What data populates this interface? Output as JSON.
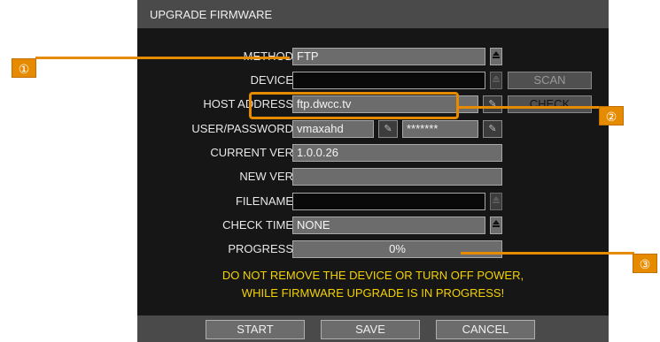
{
  "dialog": {
    "title": "UPGRADE FIRMWARE"
  },
  "form": {
    "method": {
      "label": "METHOD",
      "value": "FTP",
      "options_icon": "dropdown-arrow-icon"
    },
    "device": {
      "label": "DEVICE",
      "value": "",
      "button": "SCAN"
    },
    "host_address": {
      "label": "HOST ADDRESS",
      "value": "ftp.dwcc.tv",
      "button": "CHECK"
    },
    "user_password": {
      "label": "USER/PASSWORD",
      "user": "vmaxahd",
      "password": "*******"
    },
    "current_ver": {
      "label": "CURRENT VER",
      "value": "1.0.0.26"
    },
    "new_ver": {
      "label": "NEW VER",
      "value": ""
    },
    "filename": {
      "label": "FILENAME",
      "value": ""
    },
    "check_time": {
      "label": "CHECK TIME",
      "value": "NONE"
    },
    "progress": {
      "label": "PROGRESS",
      "value": "0%",
      "fraction": 0
    }
  },
  "warning": {
    "line1": "DO NOT REMOVE THE DEVICE OR TURN OFF POWER,",
    "line2": "WHILE FIRMWARE UPGRADE IS IN PROGRESS!"
  },
  "footer": {
    "start": "START",
    "save": "SAVE",
    "cancel": "CANCEL"
  },
  "annotations": {
    "one": "①",
    "two": "②",
    "three": "③",
    "accent_color": "#e68a00"
  }
}
